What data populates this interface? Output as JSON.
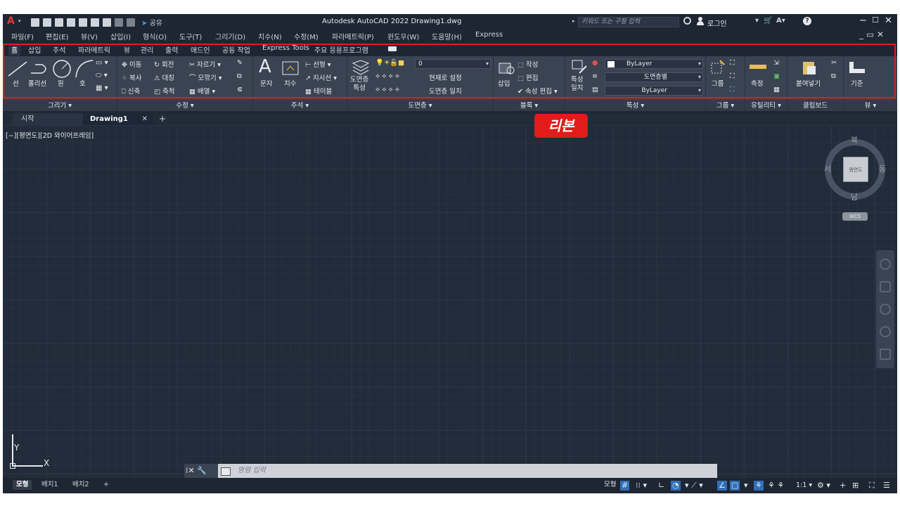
{
  "titlebar": {
    "title": "Autodesk AutoCAD 2022    Drawing1.dwg",
    "share": "공유",
    "search_placeholder": "키워드 또는 구절 입력",
    "login": "로그인",
    "logo": "A"
  },
  "menu": [
    "파일(F)",
    "편집(E)",
    "뷰(V)",
    "삽입(I)",
    "형식(O)",
    "도구(T)",
    "그리기(D)",
    "치수(N)",
    "수정(M)",
    "파라메트릭(P)",
    "윈도우(W)",
    "도움말(H)",
    "Express"
  ],
  "ribbon_tabs": [
    "홈",
    "삽입",
    "주석",
    "파라메트릭",
    "뷰",
    "관리",
    "출력",
    "애드인",
    "공동 작업",
    "Express Tools",
    "주요 응용프로그램"
  ],
  "ribbon": {
    "draw": {
      "title": "그리기 ▾",
      "line": "선",
      "polyline": "폴리선",
      "circle": "원",
      "arc": "호"
    },
    "modify": {
      "title": "수정 ▾",
      "move": "이동",
      "rotate": "회전",
      "trim": "자르기 ▾",
      "copy": "복사",
      "mirror": "대칭",
      "fillet": "모깎기 ▾",
      "stretch": "신축",
      "scale": "축척",
      "array": "배열 ▾"
    },
    "annotation": {
      "title": "주석 ▾",
      "text": "문자",
      "dimension": "치수",
      "linear": "선형 ▾",
      "leader": "지시선 ▾",
      "table": "테이블"
    },
    "layers": {
      "title": "도면층 ▾",
      "properties": "도면층\n특성",
      "layer_value": "0",
      "set_current": "현재로 설정",
      "match_layer": "도면층 일치"
    },
    "block": {
      "title": "블록 ▾",
      "insert": "삽입",
      "create": "작성",
      "edit": "편집",
      "edit_attr": "속성 편집 ▾"
    },
    "properties": {
      "title": "특성 ▾",
      "match": "특성\n일치",
      "color": "ByLayer",
      "linetype": "도면층별",
      "lineweight": "ByLayer"
    },
    "groups": {
      "title": "그룹 ▾",
      "group": "그룹"
    },
    "utilities": {
      "title": "유틸리티 ▾",
      "measure": "측정"
    },
    "clipboard": {
      "title": "클립보드",
      "paste": "붙여넣기"
    },
    "view": {
      "title": "뷰 ▾",
      "base": "기준"
    }
  },
  "callout": "리본",
  "doc_tabs": {
    "start": "시작",
    "drawing": "Drawing1",
    "close": "✕",
    "add": "+"
  },
  "canvas": {
    "view_label": "[−][평면도][2D 와이어프레임]"
  },
  "viewcube": {
    "north": "북",
    "south": "남",
    "east": "동",
    "west": "서",
    "face": "평면도",
    "wcs": "WCS"
  },
  "ucs": {
    "x": "X",
    "y": "Y"
  },
  "command": {
    "placeholder": "명령 입력"
  },
  "status": {
    "layout_tabs": [
      "모형",
      "배치1",
      "배치2"
    ],
    "model": "모형",
    "scale": "1:1"
  },
  "colors": {
    "accent_red": "#e21b1b",
    "background": "#1e2735",
    "ribbon": "#3a4352"
  }
}
